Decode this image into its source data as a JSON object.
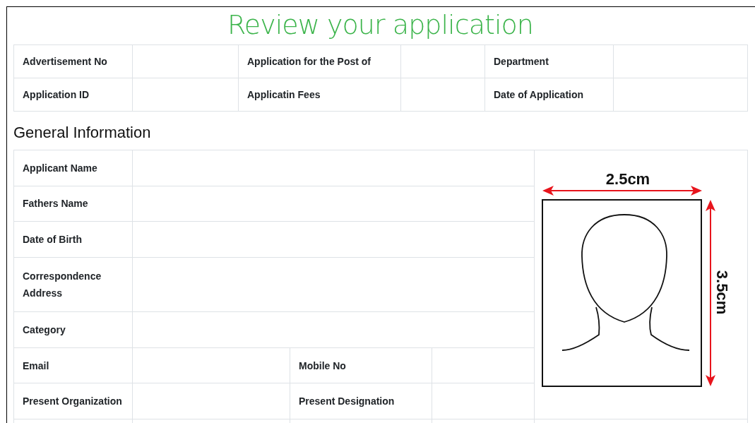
{
  "title": "Review your application",
  "summary": {
    "rows": [
      [
        "Advertisement No",
        "Application for the Post of",
        "Department"
      ],
      [
        "Application ID",
        "Applicatin Fees",
        "Date of Application"
      ]
    ]
  },
  "general": {
    "heading": "General Information",
    "rows": [
      {
        "kind": "single",
        "labels": [
          "Applicant Name"
        ]
      },
      {
        "kind": "single",
        "labels": [
          "Fathers Name"
        ]
      },
      {
        "kind": "single",
        "labels": [
          "Date of Birth"
        ]
      },
      {
        "kind": "single",
        "labels": [
          "Correspondence Address"
        ]
      },
      {
        "kind": "single",
        "labels": [
          "Category"
        ]
      },
      {
        "kind": "double",
        "labels": [
          "Email",
          "Mobile No"
        ]
      },
      {
        "kind": "double",
        "labels": [
          "Present Organization",
          "Present Designation"
        ]
      }
    ],
    "photo": {
      "width_label": "2.5cm",
      "height_label": "3.5cm"
    }
  }
}
